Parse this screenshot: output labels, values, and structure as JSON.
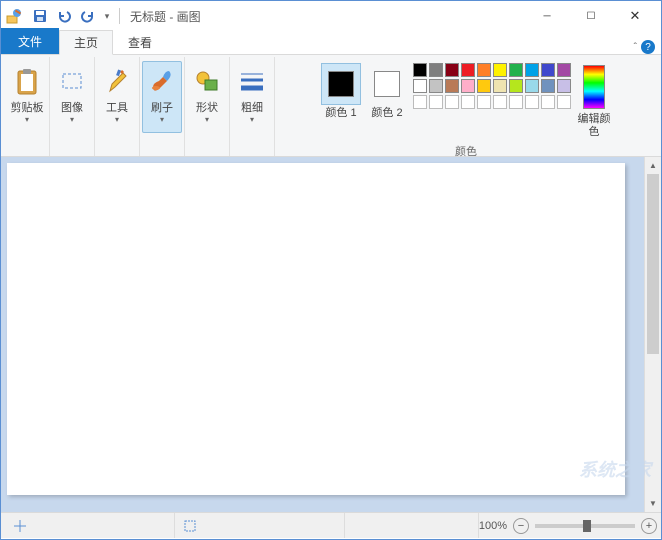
{
  "title": "无标题 - 画图",
  "tabs": {
    "file": "文件",
    "home": "主页",
    "view": "查看"
  },
  "ribbon": {
    "clipboard": {
      "label": "剪贴板"
    },
    "image": {
      "label": "图像"
    },
    "tools": {
      "label": "工具"
    },
    "brushes": {
      "label": "刷子"
    },
    "shapes": {
      "label": "形状"
    },
    "size": {
      "label": "粗细"
    },
    "color1": {
      "label": "颜色 1"
    },
    "color2": {
      "label": "颜色 2"
    },
    "colors_group": "颜色",
    "edit_colors": "编辑颜色"
  },
  "palette": {
    "row1": [
      "#000000",
      "#7f7f7f",
      "#880015",
      "#ed1c24",
      "#ff7f27",
      "#fff200",
      "#22b14c",
      "#00a2e8",
      "#3f48cc",
      "#a349a4"
    ],
    "row2": [
      "#ffffff",
      "#c3c3c3",
      "#b97a57",
      "#ffaec9",
      "#ffc90e",
      "#efe4b0",
      "#b5e61d",
      "#99d9ea",
      "#7092be",
      "#c8bfe7"
    ],
    "row3": [
      "",
      "",
      "",
      "",
      "",
      "",
      "",
      "",
      "",
      ""
    ]
  },
  "color1_value": "#000000",
  "color2_value": "#ffffff",
  "status": {
    "zoom": "100%"
  },
  "watermark": "系统之家"
}
